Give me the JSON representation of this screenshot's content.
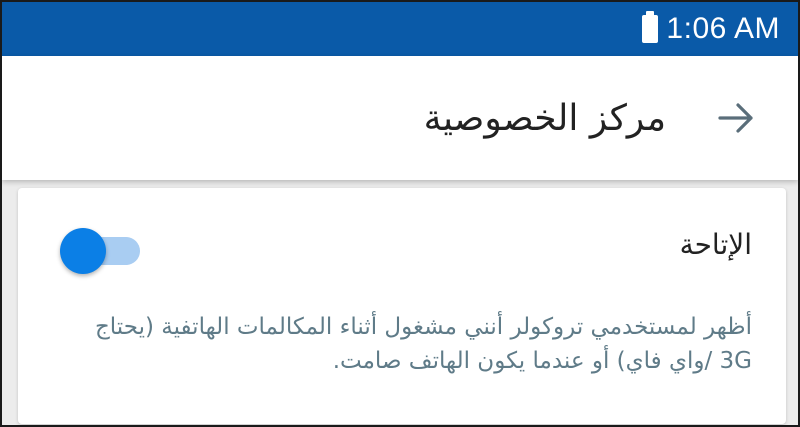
{
  "status_bar": {
    "time": "1:06 AM",
    "battery_icon": "battery-full-icon",
    "background": "#0a5aa8"
  },
  "app_bar": {
    "title": "مركز الخصوصية",
    "back_icon": "arrow-back-icon"
  },
  "setting": {
    "title": "الإتاحة",
    "description": "أظهر لمستخدمي تروكولر أنني مشغول أثناء المكالمات الهاتفية (يحتاج 3G /واي فاي) أو عندما يكون الهاتف صامت.",
    "toggle_color": "#0b7fe6",
    "toggle_track_color": "#a9cdf2"
  }
}
